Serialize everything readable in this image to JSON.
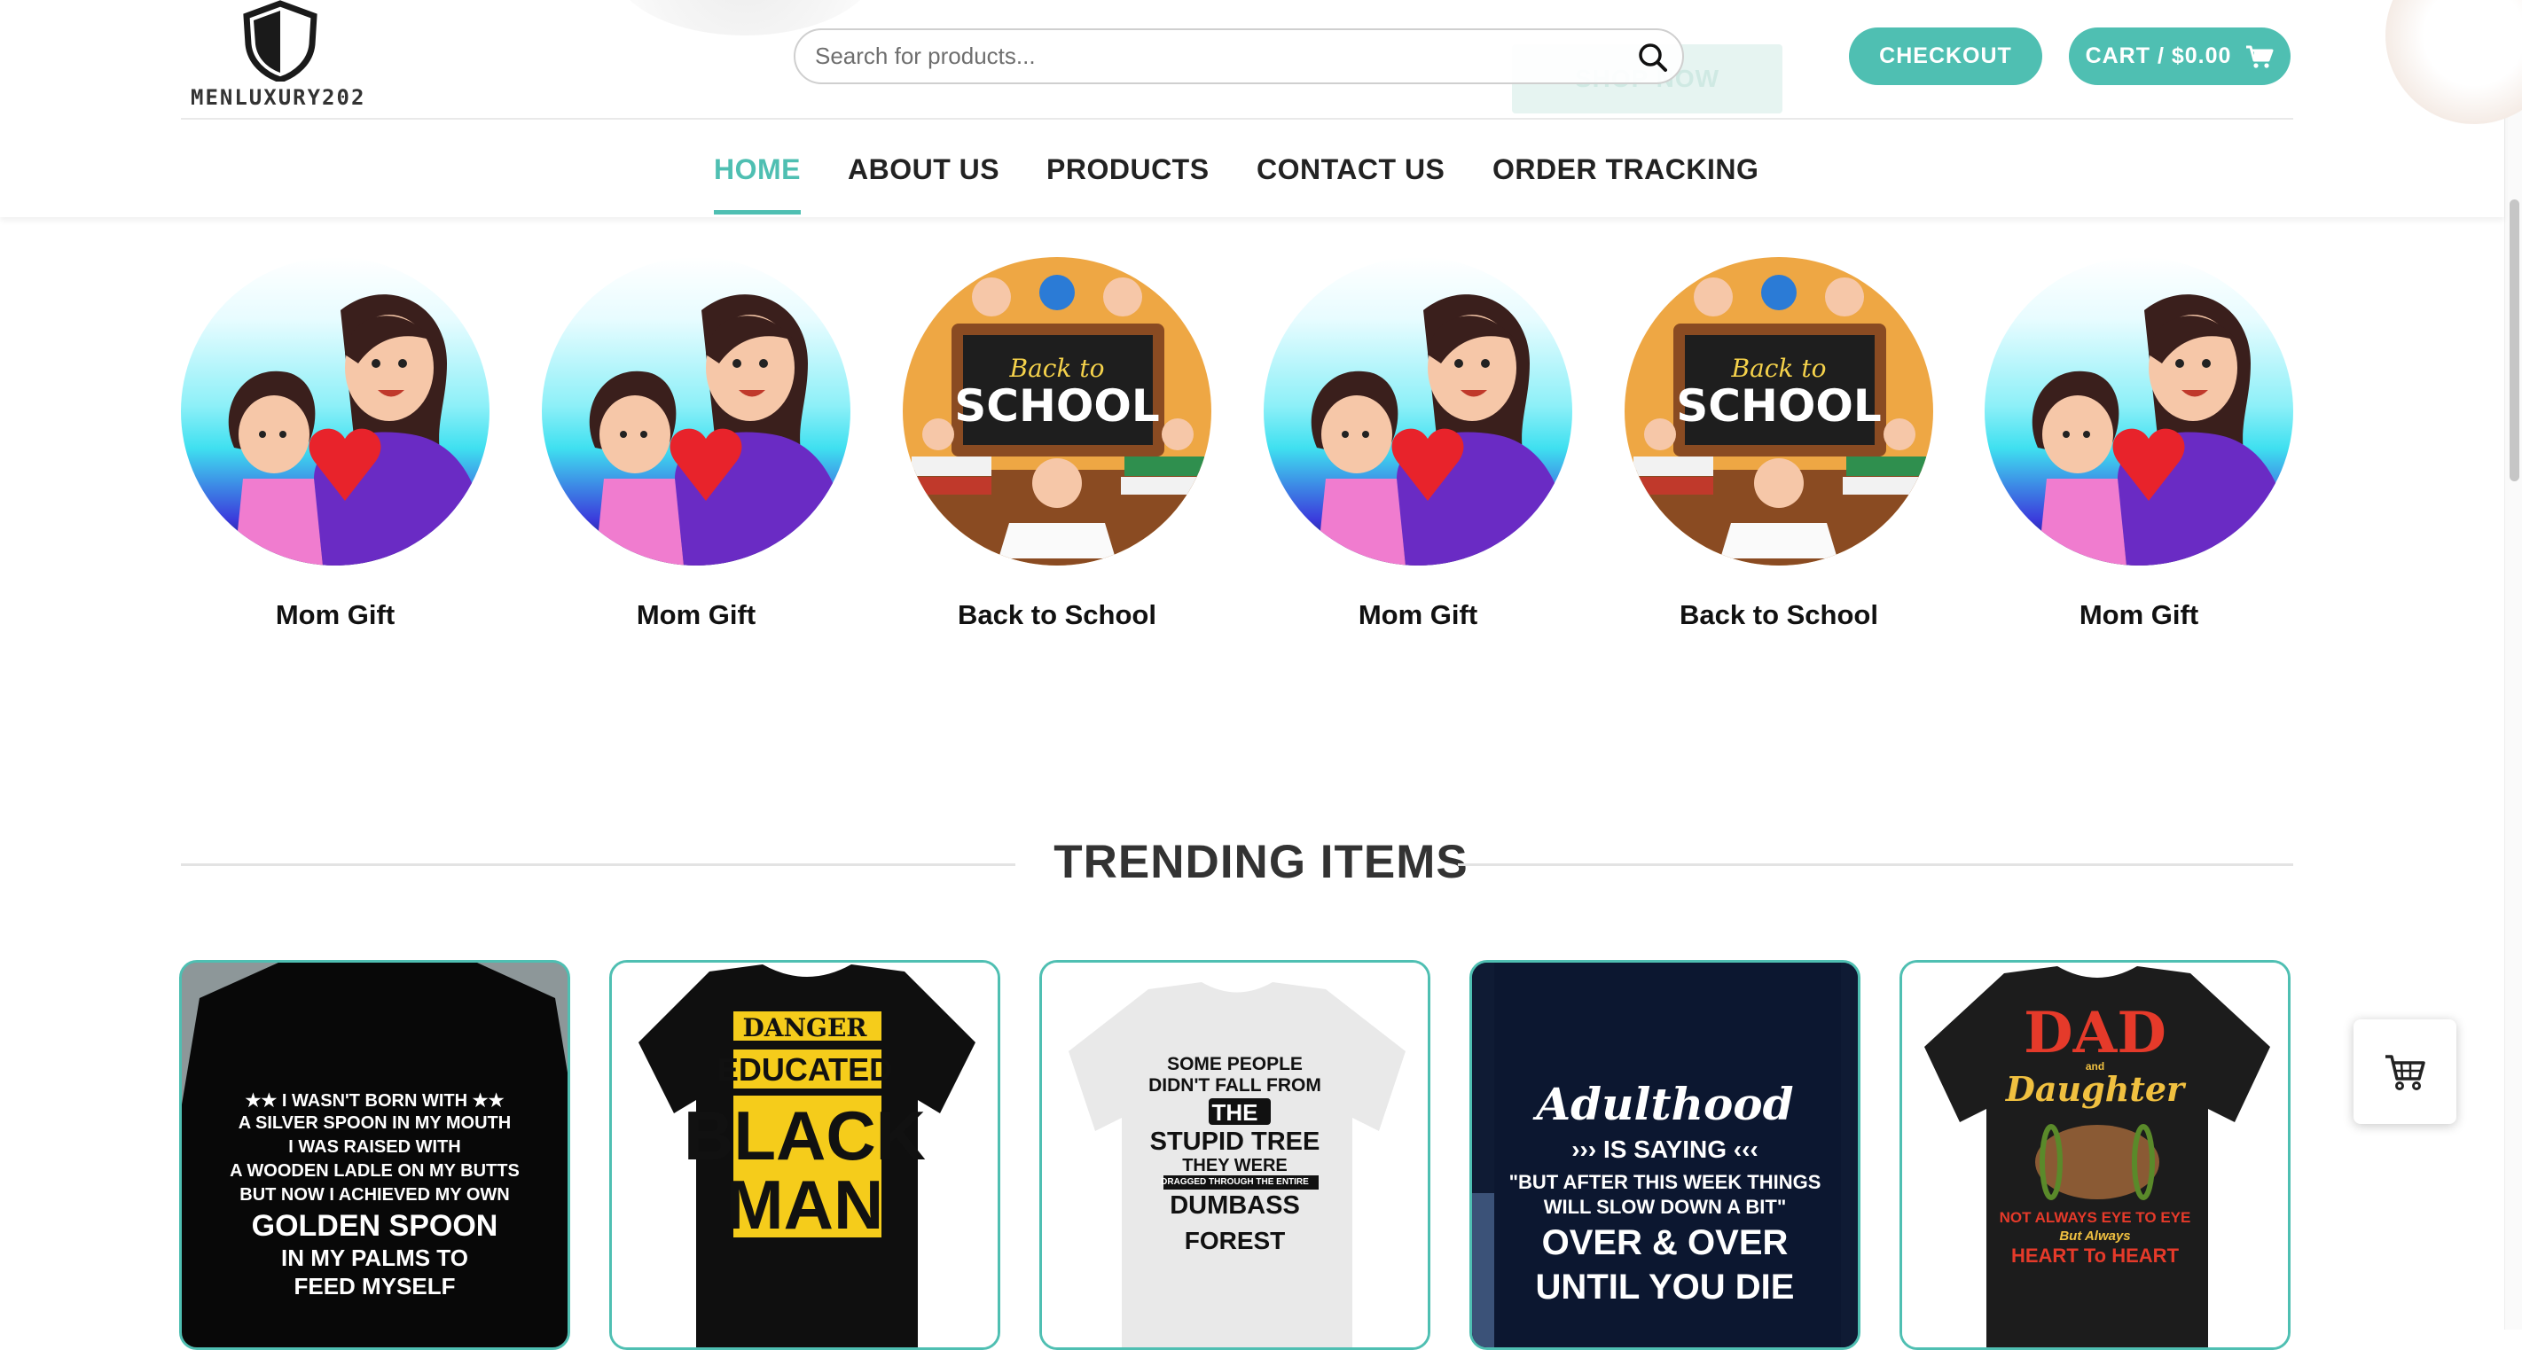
{
  "brand": {
    "name": "MENLUXURY202"
  },
  "header": {
    "search_placeholder": "Search for products...",
    "shop_now_label": "SHOP NOW",
    "checkout_label": "CHECKOUT",
    "cart_label": "CART / $0.00"
  },
  "nav": {
    "items": [
      "HOME",
      "ABOUT US",
      "PRODUCTS",
      "CONTACT US",
      "ORDER TRACKING"
    ],
    "active": "HOME"
  },
  "categories": [
    {
      "label": "Mom Gift",
      "image": "mom-gift"
    },
    {
      "label": "Mom Gift",
      "image": "mom-gift"
    },
    {
      "label": "Back to School",
      "image": "back-to-school"
    },
    {
      "label": "Mom Gift",
      "image": "mom-gift"
    },
    {
      "label": "Back to School",
      "image": "back-to-school"
    },
    {
      "label": "Mom Gift",
      "image": "mom-gift"
    }
  ],
  "school_art": {
    "line1": "Back to",
    "line2": "SCHOOL"
  },
  "trending": {
    "title": "TRENDING ITEMS",
    "products": [
      {
        "lines": [
          "★★ I WASN'T BORN WITH ★★",
          "A SILVER SPOON IN MY MOUTH",
          "I WAS RAISED WITH",
          "A WOODEN LADLE ON MY BUTTS",
          "BUT NOW I ACHIEVED MY OWN",
          "GOLDEN SPOON",
          "IN MY PALMS TO",
          "FEED MYSELF"
        ]
      },
      {
        "lines": [
          "DANGER",
          "EDUCATED",
          "BLACK",
          "MAN"
        ]
      },
      {
        "lines": [
          "SOME PEOPLE",
          "DIDN'T FALL FROM",
          "THE",
          "STUPID TREE",
          "THEY WERE",
          "DRAGGED THROUGH THE ENTIRE",
          "DUMBASS",
          "FOREST"
        ]
      },
      {
        "lines": [
          "Adulthood",
          "››› IS SAYING ‹‹‹",
          "\"BUT AFTER THIS WEEK THINGS",
          "WILL SLOW DOWN A BIT\"",
          "OVER & OVER",
          "UNTIL YOU DIE"
        ]
      },
      {
        "lines": [
          "DAD",
          "and",
          "Daughter",
          "NOT ALWAYS EYE TO EYE",
          "But Always",
          "HEART To HEART"
        ]
      }
    ]
  },
  "colors": {
    "accent": "#4fbfb2",
    "nav_text": "#222222",
    "heading": "#333333"
  },
  "icons": {
    "search": "search-icon",
    "cart": "cart-icon",
    "floating_cart": "cart-icon"
  }
}
